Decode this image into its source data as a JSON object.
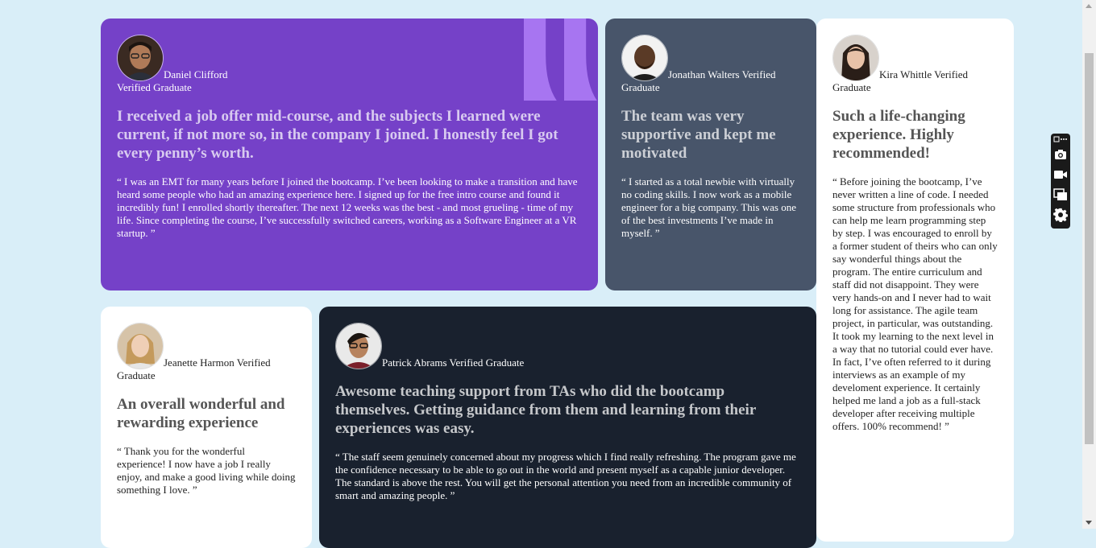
{
  "testimonials": [
    {
      "name": "Daniel Clifford",
      "status": "Verified Graduate",
      "headline": "I received a job offer mid-course, and the subjects I learned were current, if not more so, in the company I joined. I honestly feel I got every penny’s worth.",
      "quote": "“ I was an EMT for many years before I joined the bootcamp. I’ve been looking to make a transition and have heard some people who had an amazing experience here. I signed up for the free intro course and found it incredibly fun! I enrolled shortly thereafter. The next 12 weeks was the best - and most grueling - time of my life. Since completing the course, I’ve successfully switched careers, working as a Software Engineer at a VR startup. ”"
    },
    {
      "name": "Jonathan Walters",
      "status": "Verified Graduate",
      "headline": "The team was very supportive and kept me motivated",
      "quote": "“ I started as a total newbie with virtually no coding skills. I now work as a mobile engineer for a big company. This was one of the best investments I’ve made in myself. ”"
    },
    {
      "name": "Kira Whittle",
      "status": "Verified Graduate",
      "headline": "Such a life-changing experience. Highly recommended!",
      "quote": "“ Before joining the bootcamp, I’ve never written a line of code. I needed some structure from professionals who can help me learn programming step by step. I was encouraged to enroll by a former student of theirs who can only say wonderful things about the program. The entire curriculum and staff did not disappoint. They were very hands-on and I never had to wait long for assistance. The agile team project, in particular, was outstanding. It took my learning to the next level in a way that no tutorial could ever have. In fact, I’ve often referred to it during interviews as an example of my develoment experience. It certainly helped me land a job as a full-stack developer after receiving multiple offers. 100% recommend! ”"
    },
    {
      "name": "Jeanette Harmon",
      "status": "Verified Graduate",
      "headline": "An overall wonderful and rewarding experience",
      "quote": "“ Thank you for the wonderful experience! I now have a job I really enjoy, and make a good living while doing something I love. ”"
    },
    {
      "name": "Patrick Abrams",
      "status": "Verified Graduate",
      "headline": "Awesome teaching support from TAs who did the bootcamp themselves. Getting guidance from them and learning from their experiences was easy.",
      "quote": "“ The staff seem genuinely concerned about my progress which I find really refreshing. The program gave me the confidence necessary to be able to go out in the world and present myself as a capable junior developer. The standard is above the rest. You will get the personal attention you need from an incredible community of smart and amazing people. ”"
    }
  ],
  "colors": {
    "page_bg": "#d9eef8",
    "purple": "#7541c8",
    "slate": "#48556a",
    "white": "#ffffff",
    "dark": "#19212e",
    "quote_mark": "#a775f1"
  },
  "toolbar": {
    "icons": [
      "screenshot-camera-icon",
      "video-camera-icon",
      "windows-icon",
      "gear-icon"
    ]
  }
}
